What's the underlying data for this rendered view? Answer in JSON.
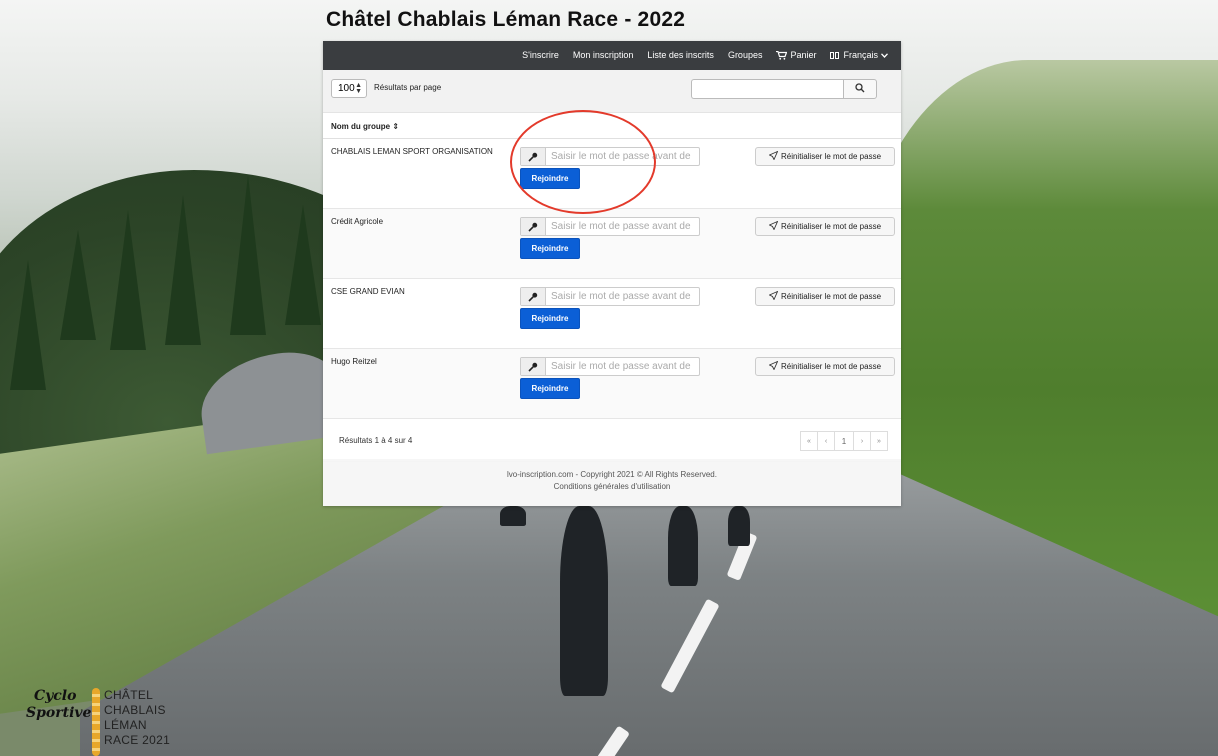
{
  "page": {
    "title": "Châtel Chablais Léman Race - 2022"
  },
  "nav": {
    "items": [
      {
        "label": "S'inscrire"
      },
      {
        "label": "Mon inscription"
      },
      {
        "label": "Liste des inscrits"
      },
      {
        "label": "Groupes"
      },
      {
        "label": "Panier",
        "icon": "cart-icon"
      },
      {
        "label": "Français",
        "icon": "flag-icon"
      }
    ]
  },
  "toolbar": {
    "per_page_value": "100",
    "per_page_label": "Résultats par page",
    "search_placeholder": "",
    "search_icon": "search-icon"
  },
  "table": {
    "column_header": "Nom du groupe ⇕",
    "password_placeholder": "Saisir le mot de passe avant de",
    "join_label": "Rejoindre",
    "reset_label": "Réinitialiser le mot de passe",
    "rows": [
      {
        "name": "CHABLAIS LEMAN SPORT ORGANISATION"
      },
      {
        "name": "Crédit Agricole"
      },
      {
        "name": "CSE GRAND EVIAN"
      },
      {
        "name": "Hugo Reitzel"
      }
    ]
  },
  "results": {
    "summary": "Résultats 1 à 4 sur 4",
    "pagination": [
      "«",
      "‹",
      "1",
      "›",
      "»"
    ]
  },
  "footer": {
    "copyright": "lvo-inscription.com - Copyright 2021 © All Rights Reserved.",
    "terms": "Conditions générales d'utilisation"
  },
  "logo": {
    "script_line1": "Cyclo",
    "script_line2": "Sportive",
    "caps": [
      "CHÂTEL",
      "CHABLAIS",
      "LÉMAN",
      "RACE 2021"
    ]
  },
  "colors": {
    "navbar": "#3a3d40",
    "join_button": "#0b5fd6",
    "annotation": "#e33a2b"
  }
}
